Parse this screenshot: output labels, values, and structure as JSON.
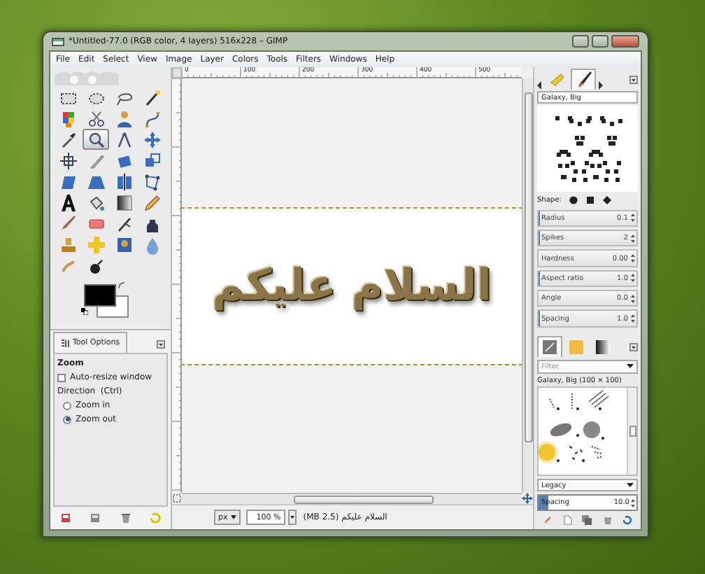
{
  "window": {
    "title": "*Untitled-77.0 (RGB color, 4 layers) 516x228 – GIMP"
  },
  "menu": [
    "File",
    "Edit",
    "Select",
    "View",
    "Image",
    "Layer",
    "Colors",
    "Tools",
    "Filters",
    "Windows",
    "Help"
  ],
  "toolbox": {
    "tools": [
      {
        "selected": false
      },
      {
        "selected": false
      },
      {
        "selected": false
      },
      {
        "selected": false
      },
      {
        "selected": false
      },
      {
        "selected": false
      },
      {
        "selected": false
      },
      {
        "selected": false
      },
      {
        "selected": false
      },
      {
        "selected": true
      },
      {
        "selected": false
      },
      {
        "selected": false
      },
      {
        "selected": false
      },
      {
        "selected": false
      },
      {
        "selected": false
      },
      {
        "selected": false
      },
      {
        "selected": false
      },
      {
        "selected": false
      },
      {
        "selected": false
      },
      {
        "selected": false
      },
      {
        "selected": false
      },
      {
        "selected": false
      },
      {
        "selected": false
      },
      {
        "selected": false
      },
      {
        "selected": false
      },
      {
        "selected": false
      },
      {
        "selected": false
      },
      {
        "selected": false
      },
      {
        "selected": false
      },
      {
        "selected": false
      },
      {
        "selected": false
      },
      {
        "selected": false
      },
      {
        "selected": false
      },
      {
        "selected": false
      }
    ],
    "tool_options": {
      "tab": "Tool Options",
      "heading": "Zoom",
      "auto_resize": {
        "label": "Auto-resize window",
        "checked": false
      },
      "direction_label": "Direction  (Ctrl)",
      "directions": [
        {
          "label": "Zoom in",
          "selected": false
        },
        {
          "label": "Zoom out",
          "selected": true
        }
      ]
    }
  },
  "canvas": {
    "ruler_labels": [
      "0",
      "100",
      "200",
      "300",
      "400",
      "500"
    ],
    "image_text": "السلام عليكم"
  },
  "status_bar": {
    "unit": "px",
    "zoom": "100 %",
    "info": "السلام عليكم (2.5 MB)"
  },
  "brush_editor": {
    "tabs": [
      {
        "selected": false
      },
      {
        "selected": true
      }
    ],
    "name": "Galaxy, Big",
    "shape_label": "Shape:",
    "params": [
      {
        "label": "Radius",
        "value": "0.1",
        "level": 0.01
      },
      {
        "label": "Spikes",
        "value": "2",
        "level": 0.02
      },
      {
        "label": "Hardness",
        "value": "0.00",
        "level": 0
      },
      {
        "label": "Aspect ratio",
        "value": "1.0",
        "level": 0.01
      },
      {
        "label": "Angle",
        "value": "0.0",
        "level": 0
      },
      {
        "label": "Spacing",
        "value": "1.0",
        "level": 0.01
      }
    ]
  },
  "brushes": {
    "tabs": [
      {
        "selected": true
      },
      {
        "selected": false
      },
      {
        "selected": false
      }
    ],
    "filter_placeholder": "Filter",
    "title": "Galaxy, Big (100 × 100)",
    "mode": "Legacy",
    "spacing": {
      "label": "Spacing",
      "value": "10.0",
      "level": 0.1
    }
  }
}
